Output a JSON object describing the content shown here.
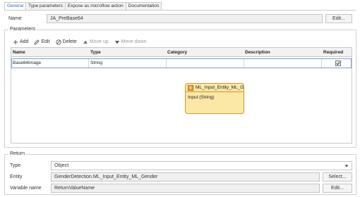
{
  "tabs": [
    {
      "label": "General",
      "active": true
    },
    {
      "label": "Type parameters",
      "active": false
    },
    {
      "label": "Expose as microflow action",
      "active": false
    },
    {
      "label": "Documentation",
      "active": false
    }
  ],
  "name": {
    "label": "Name",
    "value": "JA_PreBase64",
    "edit_label": "Edit..."
  },
  "parameters": {
    "title": "Parameters",
    "toolbar": [
      {
        "icon": "plus-icon",
        "label": "Add",
        "enabled": true
      },
      {
        "icon": "pencil-icon",
        "label": "Edit",
        "enabled": true
      },
      {
        "icon": "delete-icon",
        "label": "Delete",
        "enabled": true
      },
      {
        "icon": "arrow-up-icon",
        "label": "Move up",
        "enabled": false
      },
      {
        "icon": "arrow-down-icon",
        "label": "Move down",
        "enabled": false
      }
    ],
    "columns": [
      "Name",
      "Type",
      "Category",
      "Description",
      "Required"
    ],
    "rows": [
      {
        "name": "Base64Image",
        "type": "String",
        "category": "",
        "description": "",
        "required": true
      }
    ]
  },
  "entity_box": {
    "title": "ML_Input_Entity_ML_G...",
    "attribute": "Input (String)",
    "icon": "entity-icon"
  },
  "return": {
    "title": "Return",
    "type_label": "Type",
    "type_value": "Object",
    "entity_label": "Entity",
    "entity_value": "GenderDetection.ML_Input_Entity_ML_Gender",
    "select_label": "Select...",
    "varname_label": "Variable name",
    "varname_value": "ReturnValueName",
    "edit_label": "Edit..."
  },
  "colors": {
    "accent": "#2f6db5",
    "entity_fill": "#fbe7a6",
    "entity_border": "#c89a2b",
    "selection": "#7aa0cc"
  }
}
